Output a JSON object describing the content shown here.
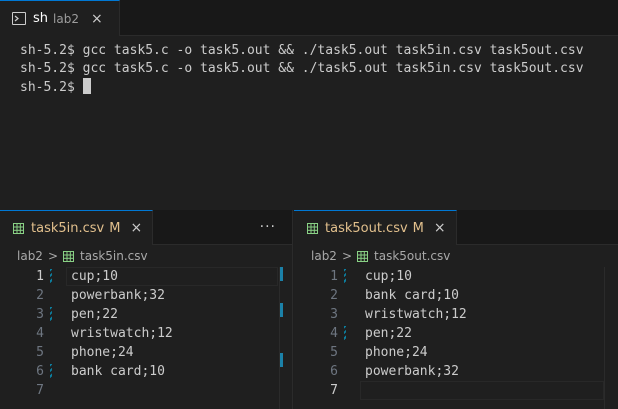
{
  "terminal": {
    "tab_name": "sh",
    "tab_sub": "lab2",
    "close_glyph": "×",
    "lines": [
      "sh-5.2$ gcc task5.c -o task5.out && ./task5.out task5in.csv task5out.csv",
      "sh-5.2$ gcc task5.c -o task5.out && ./task5.out task5in.csv task5out.csv"
    ],
    "prompt": "sh-5.2$ "
  },
  "left_editor": {
    "tab_name": "task5in.csv",
    "tab_badge": "M",
    "close_glyph": "×",
    "more_glyph": "···",
    "breadcrumb": [
      "lab2",
      "task5in.csv"
    ],
    "lines": [
      {
        "num": "1",
        "text": "cup;10"
      },
      {
        "num": "2",
        "text": "powerbank;32"
      },
      {
        "num": "3",
        "text": "pen;22"
      },
      {
        "num": "4",
        "text": "wristwatch;12"
      },
      {
        "num": "5",
        "text": "phone;24"
      },
      {
        "num": "6",
        "text": "bank card;10"
      },
      {
        "num": "7",
        "text": ""
      }
    ]
  },
  "right_editor": {
    "tab_name": "task5out.csv",
    "tab_badge": "M",
    "close_glyph": "×",
    "breadcrumb": [
      "lab2",
      "task5out.csv"
    ],
    "lines": [
      {
        "num": "1",
        "text": "cup;10"
      },
      {
        "num": "2",
        "text": "bank card;10"
      },
      {
        "num": "3",
        "text": "wristwatch;12"
      },
      {
        "num": "4",
        "text": "pen;22"
      },
      {
        "num": "5",
        "text": "phone;24"
      },
      {
        "num": "6",
        "text": "powerbank;32"
      },
      {
        "num": "7",
        "text": ""
      }
    ]
  },
  "breadcrumb_separator": ">",
  "colors": {
    "accent": "#0078d4",
    "modified": "#e2c08d",
    "csv_icon": "#89d185",
    "gutter_modified": "#0c7d9d"
  },
  "icons": {
    "terminal": "terminal-icon",
    "csv": "csv-file-icon",
    "close": "close-icon",
    "more": "more-actions-icon",
    "chevron": "chevron-right-icon"
  }
}
